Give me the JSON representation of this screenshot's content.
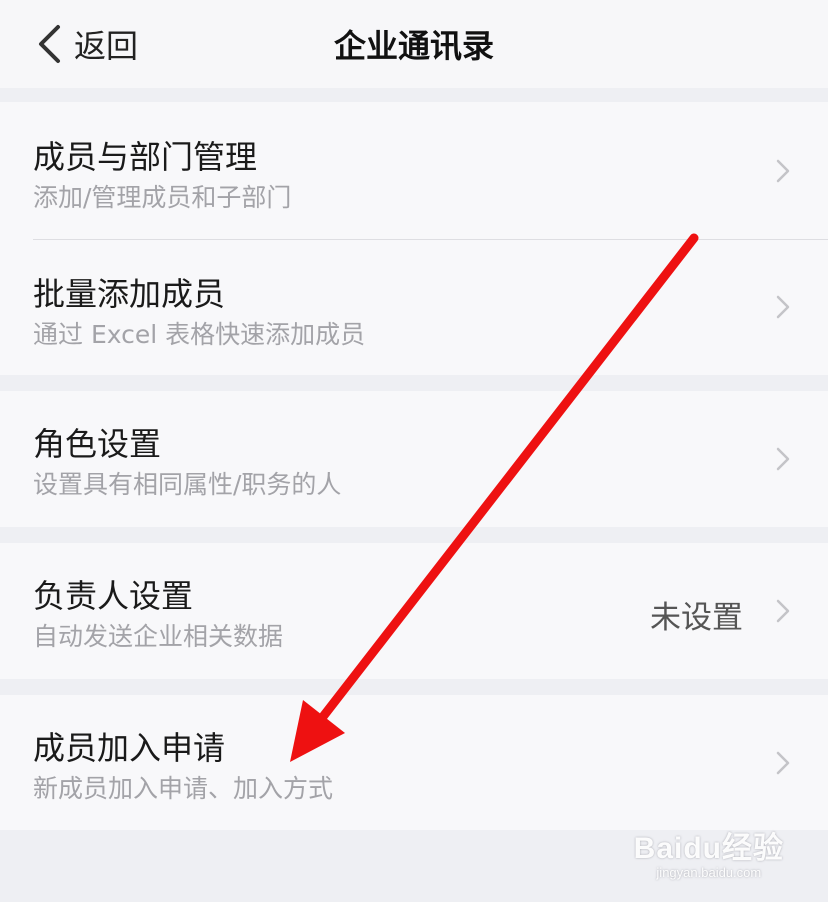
{
  "nav": {
    "back_label": "返回",
    "title": "企业通讯录"
  },
  "items": [
    {
      "title": "成员与部门管理",
      "subtitle": "添加/管理成员和子部门"
    },
    {
      "title": "批量添加成员",
      "subtitle": "通过 Excel 表格快速添加成员"
    },
    {
      "title": "角色设置",
      "subtitle": "设置具有相同属性/职务的人"
    },
    {
      "title": "负责人设置",
      "subtitle": "自动发送企业相关数据",
      "value": "未设置"
    },
    {
      "title": "成员加入申请",
      "subtitle": "新成员加入申请、加入方式"
    }
  ],
  "icons": {
    "back": "chevron-left-icon",
    "row": "chevron-right-icon"
  },
  "colors": {
    "annotation_arrow": "#ee1111",
    "background": "#eeeff3",
    "cell": "#f8f8fa"
  },
  "watermark": {
    "logo": "Baidu经验",
    "url": "jingyan.baidu.com"
  }
}
